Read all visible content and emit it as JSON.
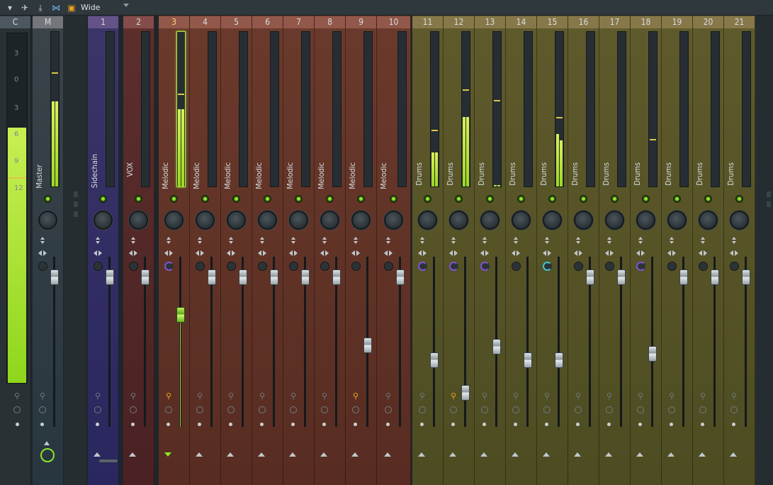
{
  "toolbar": {
    "view_mode": "Wide",
    "icons": [
      "menu-arrow-icon",
      "wand-icon",
      "anchor-icon",
      "bowtie-icon",
      "layout-icon"
    ]
  },
  "colors": {
    "accent_green": "#8ee52a",
    "purple_group": "#4a3f7e",
    "red_group": "#6e3b36",
    "brown_group": "#5a3a30",
    "olive_group": "#4b462c"
  },
  "current_strip": {
    "label": "C",
    "scale": [
      "3",
      "0",
      "3",
      "6",
      "9",
      "12"
    ],
    "level": 0.73
  },
  "strips": [
    {
      "id": "M",
      "name": "Master",
      "color": "#3a4449",
      "level": 0.55,
      "level2": 0.55,
      "peak": 0.73,
      "fader": 0.88,
      "solo_on": false,
      "pan": "none"
    },
    {
      "id": "1",
      "name": "Sidechain",
      "color": "#3b3568",
      "level": 0,
      "peak": null,
      "fader": 0.88,
      "solo_on": false,
      "pan": "none"
    },
    {
      "id": "2",
      "name": "VOX",
      "color": "#5c2f2d",
      "level": 0,
      "peak": null,
      "fader": 0.88,
      "solo_on": false,
      "pan": "none"
    },
    {
      "id": "3",
      "name": "Melodic",
      "color": "#6a3a2c",
      "level": 0.5,
      "level2": 0.5,
      "peak": 0.59,
      "fader": 0.66,
      "solo_on": true,
      "pan": "purple",
      "selected": true
    },
    {
      "id": "4",
      "name": "Melodic",
      "color": "#6a3a2c",
      "level": 0,
      "peak": null,
      "fader": 0.88,
      "solo_on": false,
      "pan": "none"
    },
    {
      "id": "5",
      "name": "Melodic",
      "color": "#6a3a2c",
      "level": 0,
      "peak": null,
      "fader": 0.88,
      "solo_on": false,
      "pan": "none"
    },
    {
      "id": "6",
      "name": "Melodic",
      "color": "#6a3a2c",
      "level": 0,
      "peak": null,
      "fader": 0.88,
      "solo_on": false,
      "pan": "none"
    },
    {
      "id": "7",
      "name": "Melodic",
      "color": "#6a3a2c",
      "level": 0,
      "peak": null,
      "fader": 0.88,
      "solo_on": false,
      "pan": "none"
    },
    {
      "id": "8",
      "name": "Melodic",
      "color": "#6a3a2c",
      "level": 0,
      "peak": null,
      "fader": 0.88,
      "solo_on": false,
      "pan": "none"
    },
    {
      "id": "9",
      "name": "Melodic",
      "color": "#6a3a2c",
      "level": 0,
      "peak": null,
      "fader": 0.48,
      "solo_on": true,
      "pan": "none"
    },
    {
      "id": "10",
      "name": "Melodic",
      "color": "#6a3a2c",
      "level": 0,
      "peak": null,
      "fader": 0.88,
      "solo_on": false,
      "pan": "none"
    },
    {
      "id": "11",
      "name": "Drums",
      "color": "#5f5a2c",
      "level": 0.22,
      "level2": 0.22,
      "peak": 0.36,
      "fader": 0.39,
      "solo_on": false,
      "pan": "purple"
    },
    {
      "id": "12",
      "name": "Drums",
      "color": "#5f5a2c",
      "level": 0.45,
      "level2": 0.45,
      "peak": 0.62,
      "fader": 0.2,
      "solo_on": true,
      "pan": "purple"
    },
    {
      "id": "13",
      "name": "Drums",
      "color": "#5f5a2c",
      "level": 0.01,
      "level2": 0.01,
      "peak": 0.55,
      "fader": 0.47,
      "solo_on": false,
      "pan": "purple"
    },
    {
      "id": "14",
      "name": "Drums",
      "color": "#5f5a2c",
      "level": 0,
      "peak": null,
      "fader": 0.39,
      "solo_on": false,
      "pan": "none"
    },
    {
      "id": "15",
      "name": "Drums",
      "color": "#5f5a2c",
      "level": 0.34,
      "level2": 0.3,
      "peak": 0.44,
      "fader": 0.39,
      "solo_on": false,
      "pan": "cyan"
    },
    {
      "id": "16",
      "name": "Drums",
      "color": "#5f5a2c",
      "level": 0,
      "peak": null,
      "fader": 0.88,
      "solo_on": false,
      "pan": "none"
    },
    {
      "id": "17",
      "name": "Drums",
      "color": "#5f5a2c",
      "level": 0,
      "peak": null,
      "fader": 0.88,
      "solo_on": false,
      "pan": "none"
    },
    {
      "id": "18",
      "name": "Drums",
      "color": "#5f5a2c",
      "level": 0,
      "peak": 0.3,
      "fader": 0.43,
      "solo_on": false,
      "pan": "purple"
    },
    {
      "id": "19",
      "name": "Drums",
      "color": "#5f5a2c",
      "level": 0,
      "peak": null,
      "fader": 0.88,
      "solo_on": false,
      "pan": "none"
    },
    {
      "id": "20",
      "name": "Drums",
      "color": "#5f5a2c",
      "level": 0,
      "peak": null,
      "fader": 0.88,
      "solo_on": false,
      "pan": "none"
    },
    {
      "id": "21",
      "name": "Drums",
      "color": "#5f5a2c",
      "level": 0,
      "peak": null,
      "fader": 0.88,
      "solo_on": false,
      "pan": "none"
    }
  ]
}
